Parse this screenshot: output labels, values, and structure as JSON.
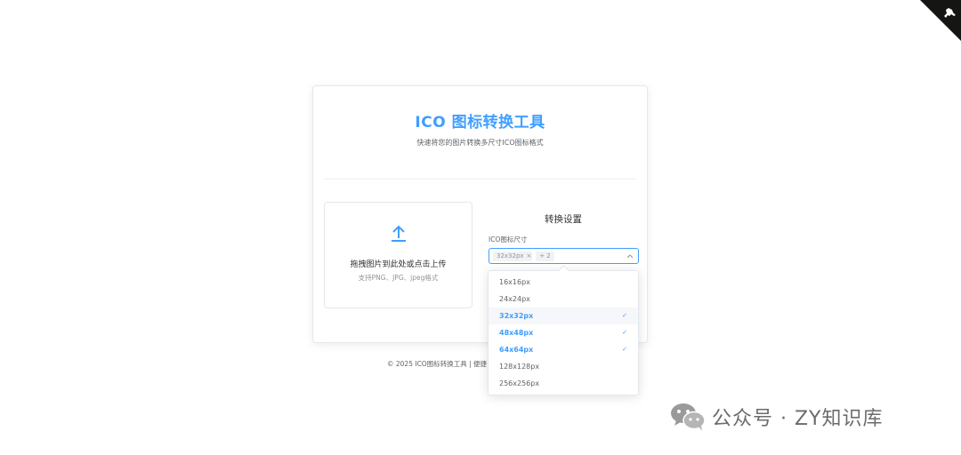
{
  "header": {
    "title": "ICO 图标转换工具",
    "subtitle": "快速将您的图片转换多尺寸ICO图标格式"
  },
  "upload": {
    "text": "拖拽图片到此处或点击上传",
    "tip": "支持PNG、JPG、jpeg格式",
    "icon": "upload-icon"
  },
  "settings": {
    "title": "转换设置",
    "size_label": "ICO图标尺寸",
    "selected_tag": "32x32px",
    "extra_count_tag": "+ 2",
    "options": [
      {
        "label": "16x16px",
        "selected": false
      },
      {
        "label": "24x24px",
        "selected": false
      },
      {
        "label": "32x32px",
        "selected": true
      },
      {
        "label": "48x48px",
        "selected": true
      },
      {
        "label": "64x64px",
        "selected": true
      },
      {
        "label": "128x128px",
        "selected": false
      },
      {
        "label": "256x256px",
        "selected": false
      }
    ],
    "check_mark": "✓",
    "tag_close": "×"
  },
  "footer": {
    "text": "© 2025 ICO图标转换工具 | 便捷"
  },
  "watermark": {
    "text": "公众号 · ZY知识库"
  },
  "colors": {
    "primary": "#409eff",
    "text": "#303133",
    "secondary_text": "#606266",
    "muted": "#909399"
  }
}
